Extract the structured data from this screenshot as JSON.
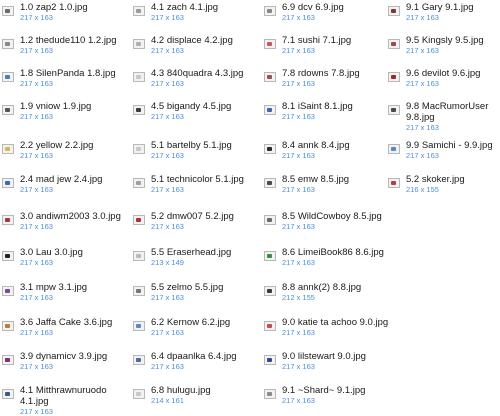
{
  "files": [
    [
      {
        "name": "1.0 zap2 1.0.jpg",
        "dims": "217 x 163",
        "icon_color": "#6b6b6b"
      },
      {
        "name": "1.2 thedude110 1.2.jpg",
        "dims": "217 x 163",
        "icon_color": "#8a8a8a"
      },
      {
        "name": "1.8 SilenPanda 1.8.jpg",
        "dims": "217 x 163",
        "icon_color": "#4a7fb5"
      },
      {
        "name": "1.9 vniow 1.9.jpg",
        "dims": "217 x 163",
        "icon_color": "#555555"
      },
      {
        "name": "2.2 yellow 2.2.jpg",
        "dims": "217 x 163",
        "icon_color": "#d9b84a"
      },
      {
        "name": "2.4 mad jew 2.4.jpg",
        "dims": "217 x 163",
        "icon_color": "#2f6fb0"
      },
      {
        "name": "3.0 andiwm2003 3.0.jpg",
        "dims": "217 x 163",
        "icon_color": "#a33a3a"
      },
      {
        "name": "3.0 Lau 3.0.jpg",
        "dims": "217 x 163",
        "icon_color": "#222222"
      },
      {
        "name": "3.1 mpw 3.1.jpg",
        "dims": "217 x 163",
        "icon_color": "#7a4a9a"
      },
      {
        "name": "3.6 Jaffa Cake 3.6.jpg",
        "dims": "217 x 163",
        "icon_color": "#c07a3a"
      },
      {
        "name": "3.9 dynamicv 3.9.jpg",
        "dims": "217 x 163",
        "icon_color": "#8a2a6a"
      },
      {
        "name": "4.1 Mitthrawnuruodo 4.1.jpg",
        "dims": "217 x 163",
        "icon_color": "#3a5a8a"
      }
    ],
    [
      {
        "name": "4.1 zach 4.1.jpg",
        "dims": "217 x 163",
        "icon_color": "#9a9a9a"
      },
      {
        "name": "4.2 displace 4.2.jpg",
        "dims": "217 x 163",
        "icon_color": "#b0b0b0"
      },
      {
        "name": "4.3 840quadra 4.3.jpg",
        "dims": "217 x 163",
        "icon_color": "#c8c8c8"
      },
      {
        "name": "4.5 bigandy 4.5.jpg",
        "dims": "217 x 163",
        "icon_color": "#3a3a3a"
      },
      {
        "name": "5.1 bartelby 5.1.jpg",
        "dims": "217 x 163",
        "icon_color": "#c8c8c8"
      },
      {
        "name": "5.1 technicolor 5.1.jpg",
        "dims": "217 x 163",
        "icon_color": "#a0a0a0"
      },
      {
        "name": "5.2 dmw007 5.2.jpg",
        "dims": "217 x 163",
        "icon_color": "#b03030"
      },
      {
        "name": "5.5 Eraserhead.jpg",
        "dims": "213 x 149",
        "icon_color": "#bbbbbb"
      },
      {
        "name": "5.5 zelmo 5.5.jpg",
        "dims": "217 x 163",
        "icon_color": "#777777"
      },
      {
        "name": "6.2 Kernow 6.2.jpg",
        "dims": "217 x 163",
        "icon_color": "#5a8ac8"
      },
      {
        "name": "6.4 dpaanlka 6.4.jpg",
        "dims": "217 x 163",
        "icon_color": "#4a6a9a"
      },
      {
        "name": "6.8 hulugu.jpg",
        "dims": "214 x 161",
        "icon_color": "#c8c8c8"
      }
    ],
    [
      {
        "name": "6.9 dcv 6.9.jpg",
        "dims": "217 x 163",
        "icon_color": "#888888"
      },
      {
        "name": "7.1 sushi 7.1.jpg",
        "dims": "217 x 163",
        "icon_color": "#c85a5a"
      },
      {
        "name": "7.8 rdowns 7.8.jpg",
        "dims": "217 x 163",
        "icon_color": "#a05050"
      },
      {
        "name": "8.1 iSaint 8.1.jpg",
        "dims": "217 x 163",
        "icon_color": "#3a6aaa"
      },
      {
        "name": "8.4 annk 8.4.jpg",
        "dims": "217 x 163",
        "icon_color": "#2a2a2a"
      },
      {
        "name": "8.5 emw 8.5.jpg",
        "dims": "217 x 163",
        "icon_color": "#4a4a4a"
      },
      {
        "name": "8.5 WildCowboy 8.5.jpg",
        "dims": "217 x 163",
        "icon_color": "#6a6a6a"
      },
      {
        "name": "8.6 LimeiBook86 8.6.jpg",
        "dims": "217 x 163",
        "icon_color": "#3a8a4a"
      },
      {
        "name": "8.8 annk(2) 8.8.jpg",
        "dims": "212 x 155",
        "icon_color": "#3a3a3a"
      },
      {
        "name": "9.0 katie ta achoo 9.0.jpg",
        "dims": "217 x 163",
        "icon_color": "#c05050"
      },
      {
        "name": "9.0 lilstewart 9.0.jpg",
        "dims": "217 x 163",
        "icon_color": "#2a4a8a"
      },
      {
        "name": "9.1 ~Shard~ 9.1.jpg",
        "dims": "217 x 163",
        "icon_color": "#8a8a8a"
      }
    ],
    [
      {
        "name": "9.1 Gary 9.1.jpg",
        "dims": "217 x 163",
        "icon_color": "#7a3a3a"
      },
      {
        "name": "9.5 Kingsly 9.5.jpg",
        "dims": "217 x 163",
        "icon_color": "#9a4a4a"
      },
      {
        "name": "9.6 devilot 9.6.jpg",
        "dims": "217 x 163",
        "icon_color": "#a02a2a"
      },
      {
        "name": "9.8 MacRumorUser 9.8.jpg",
        "dims": "217 x 163",
        "icon_color": "#4a4a4a"
      },
      {
        "name": "9.9 Samichi - 9.9.jpg",
        "dims": "217 x 163",
        "icon_color": "#5a8ac8"
      },
      {
        "name": "5.2 skoker.jpg",
        "dims": "216 x 155",
        "icon_color": "#b04040"
      }
    ]
  ]
}
